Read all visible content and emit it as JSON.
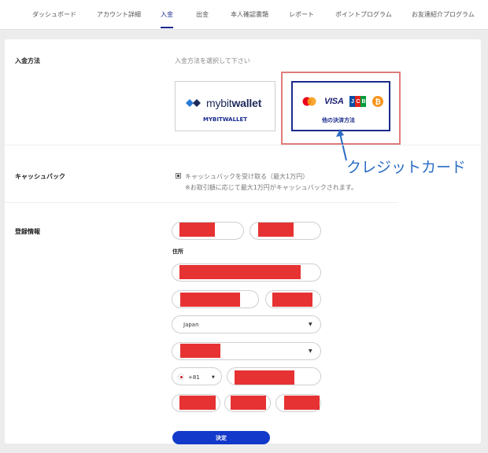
{
  "nav": {
    "items": [
      {
        "label": "ダッシュボード"
      },
      {
        "label": "アカウント詳細"
      },
      {
        "label": "入金",
        "active": true
      },
      {
        "label": "出金"
      },
      {
        "label": "本人確認書類"
      },
      {
        "label": "レポート"
      },
      {
        "label": "ポイントプログラム"
      },
      {
        "label": "お友達紹介プログラム"
      }
    ]
  },
  "deposit": {
    "section_label": "入金方法",
    "hint": "入金方法を選択して下さい",
    "options": [
      {
        "label": "MYBITWALLET",
        "logo_text_light": "mybit",
        "logo_text_bold": "wallet"
      },
      {
        "label": "他の決済方法",
        "logos": [
          "mastercard-icon",
          "visa-icon",
          "jcb-icon",
          "bitcoin-icon"
        ],
        "visa_text": "VISA",
        "bitcoin_symbol": "₿",
        "jcb_letters": [
          "J",
          "C",
          "B"
        ]
      }
    ],
    "annotation": "クレジットカード"
  },
  "cashback": {
    "section_label": "キャッシュバック",
    "checkbox_label": "キャッシュバックを受け取る（最大1万円）",
    "note": "※お取引額に応じて最大1万円がキャッシュバックされます。"
  },
  "registration": {
    "section_label": "登録情報",
    "address_label": "住所",
    "country_value": "Japan",
    "phone_code": "+81",
    "submit_label": "決定"
  },
  "colors": {
    "accent": "#1239c9",
    "highlight_border": "#e07c7c",
    "redaction": "#e63232",
    "annotation": "#2b6cc4"
  }
}
